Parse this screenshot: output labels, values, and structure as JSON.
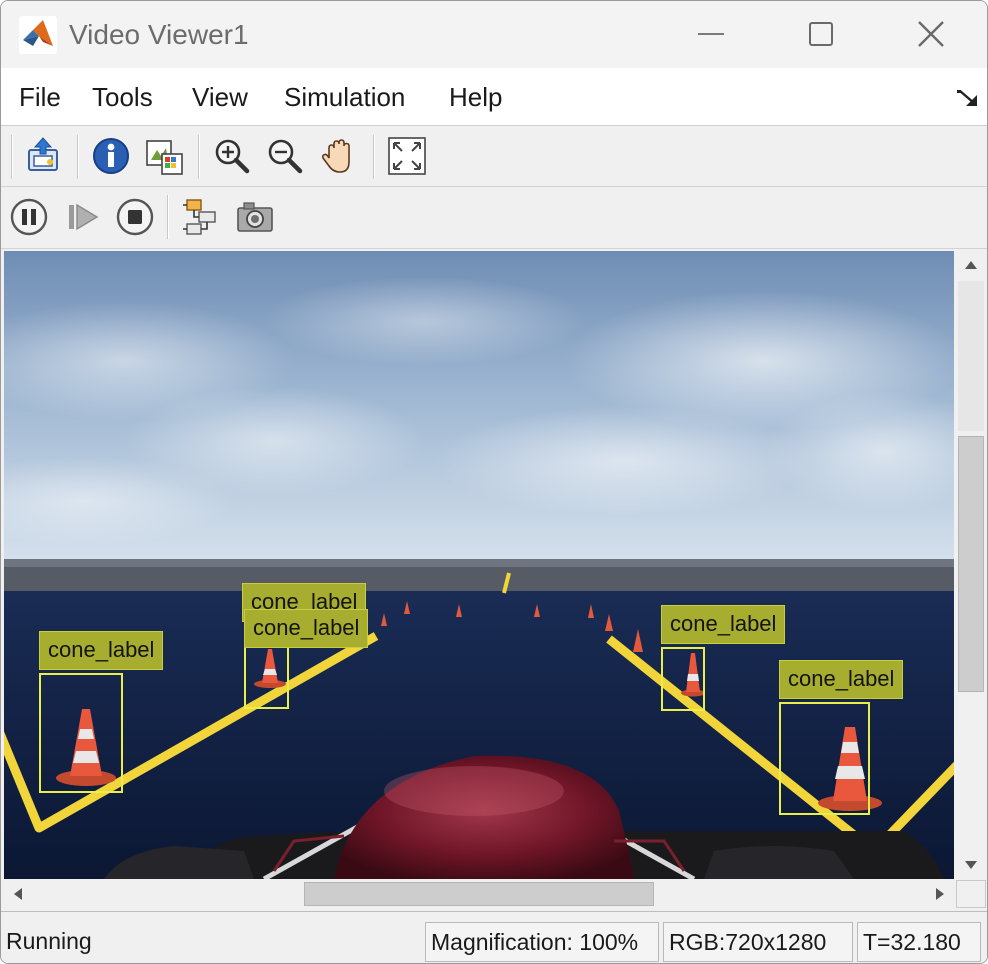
{
  "window": {
    "title": "Video Viewer1"
  },
  "menu": {
    "file": "File",
    "tools": "Tools",
    "view": "View",
    "simulation": "Simulation",
    "help": "Help"
  },
  "toolbar1": {
    "icons": [
      "print-icon",
      "info-icon",
      "colormap-icon",
      "zoom-in-icon",
      "zoom-out-icon",
      "pan-hand-icon",
      "fit-to-view-icon"
    ]
  },
  "toolbar2": {
    "icons": [
      "pause-icon",
      "step-forward-icon",
      "stop-icon",
      "simulink-model-icon",
      "snapshot-camera-icon"
    ]
  },
  "detections": [
    {
      "label": "cone_label"
    },
    {
      "label": "cone_label"
    },
    {
      "label": "cone_label"
    },
    {
      "label": "cone_label"
    },
    {
      "label": "cone_label"
    }
  ],
  "status": {
    "state": "Running",
    "magnification": "Magnification: 100%",
    "image_info": "RGB:720x1280",
    "time": "T=32.180"
  },
  "colors": {
    "detection_box": "#e8ee4a",
    "detection_label_bg": "#a7ad2e",
    "track_line": "#f2d53a",
    "sky_top": "#6f8db4",
    "ground": "#0c1a3a"
  }
}
